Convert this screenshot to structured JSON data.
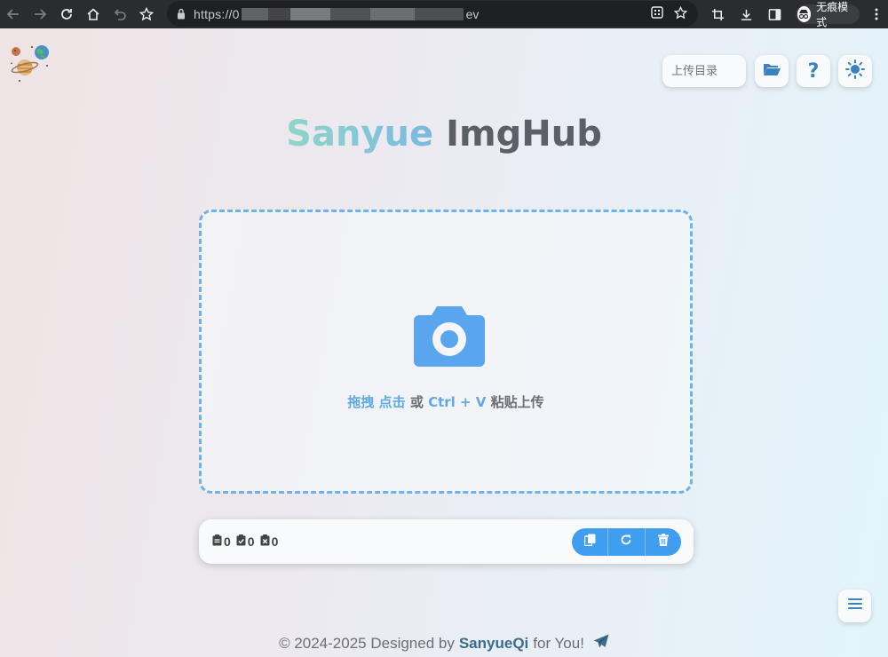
{
  "browser": {
    "url_prefix": "https://0",
    "url_suffix": "ev",
    "incognito_label": "无痕模式"
  },
  "header": {
    "dir_placeholder": "上传目录",
    "help_label": "?"
  },
  "title": {
    "part1": "Sanyue",
    "part2": "ImgHub"
  },
  "dropzone": {
    "drag": "拖拽",
    "click": "点击",
    "or": "或",
    "shortcut": "Ctrl + V",
    "paste": "粘贴上传"
  },
  "toolbar": {
    "total_count": "0",
    "success_count": "0",
    "failed_count": "0"
  },
  "footer": {
    "prefix": "© 2024-2025 Designed by",
    "author": "SanyueQi",
    "suffix": "for You!"
  },
  "colors": {
    "accent": "#3f9ef0",
    "dropzone_border": "#6fb1ea",
    "icon_blue": "#3b82c4"
  }
}
